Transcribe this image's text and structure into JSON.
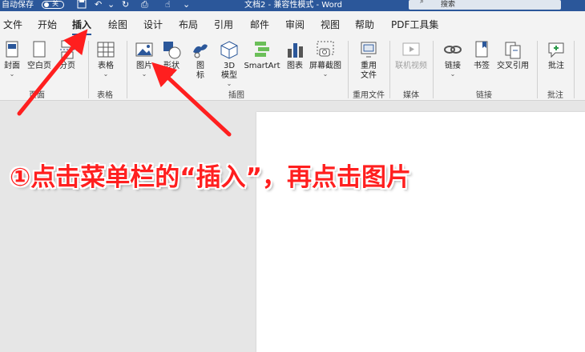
{
  "titlebar": {
    "autosave_label": "自动保存",
    "autosave_state": "关",
    "doc_title": "文档2 - 兼容性模式 - Word",
    "search_placeholder": "搜索"
  },
  "menu": {
    "tabs": [
      {
        "label": "文件"
      },
      {
        "label": "开始"
      },
      {
        "label": "插入"
      },
      {
        "label": "绘图"
      },
      {
        "label": "设计"
      },
      {
        "label": "布局"
      },
      {
        "label": "引用"
      },
      {
        "label": "邮件"
      },
      {
        "label": "审阅"
      },
      {
        "label": "视图"
      },
      {
        "label": "帮助"
      },
      {
        "label": "PDF工具集"
      }
    ],
    "active": "插入"
  },
  "ribbon": {
    "buttons": {
      "cover": "封面",
      "blank": "空白页",
      "pagebreak": "分页",
      "table": "表格",
      "picture": "图片",
      "shapes": "形状",
      "icons": "图标",
      "model3d": "3D 模型",
      "smartart": "SmartArt",
      "chart": "图表",
      "screenshot": "屏幕截图",
      "reuse": "重用文件",
      "video": "联机视频",
      "link": "链接",
      "bookmark": "书签",
      "crossref": "交叉引用",
      "comment": "批注"
    },
    "groups": {
      "pages": "页面",
      "tables": "表格",
      "illustrations": "插图",
      "reuse": "重用文件",
      "media": "媒体",
      "links": "链接",
      "comments": "批注"
    }
  },
  "annotation": {
    "text": "①点击菜单栏的“插入”，再点击图片"
  },
  "colors": {
    "titlebar": "#2b579a",
    "annotation": "#ff1f1f"
  }
}
